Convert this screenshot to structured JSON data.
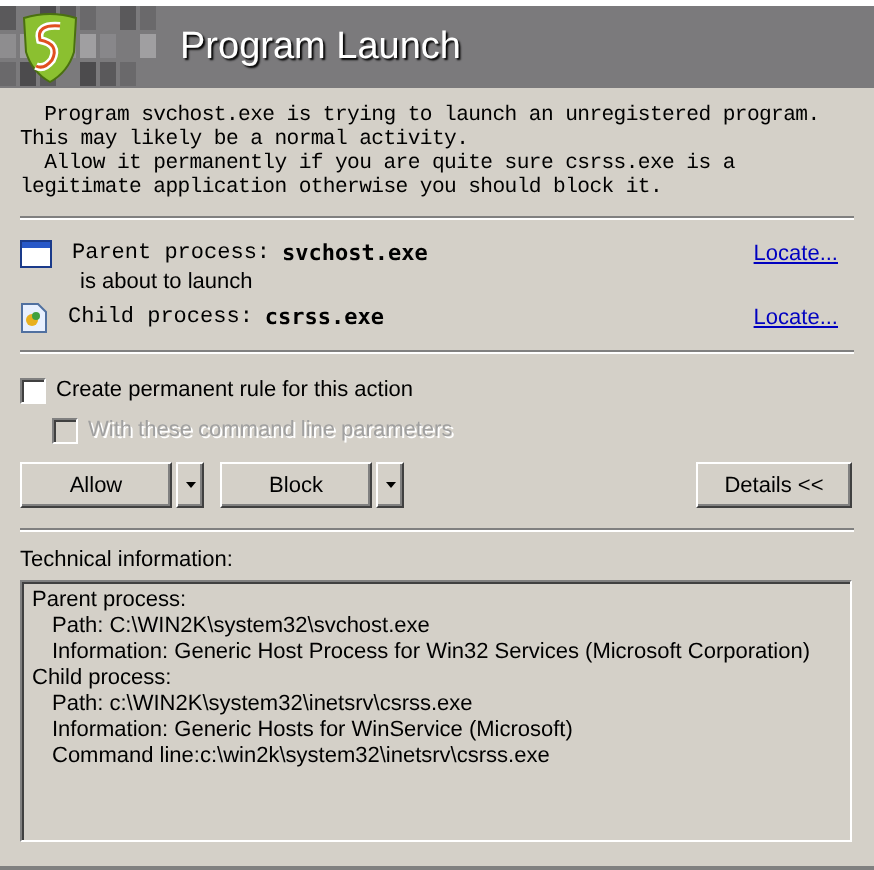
{
  "window": {
    "title": "Program Launch"
  },
  "message": "  Program svchost.exe is trying to launch an unregistered program.\nThis may likely be a normal activity.\n  Allow it permanently if you are quite sure csrss.exe is a\nlegitimate application otherwise you should block it.",
  "parent": {
    "label": "Parent process:",
    "name": "svchost.exe",
    "link": "Locate..."
  },
  "between": "is about to launch",
  "child": {
    "label": "Child process:",
    "name": "csrss.exe",
    "link": "Locate..."
  },
  "options": [
    {
      "label": "Create permanent rule for this action",
      "checked": false,
      "disabled": false
    },
    {
      "label": "With these command line parameters",
      "checked": false,
      "disabled": true
    }
  ],
  "buttons": [
    {
      "label": "Allow",
      "kind": "split"
    },
    {
      "label": "Block",
      "kind": "split"
    },
    {
      "label": "Details <<",
      "kind": "plain"
    }
  ],
  "technical": {
    "label": "Technical information:",
    "lines": [
      {
        "text": "Parent process:",
        "children": [
          {
            "text": "Path: C:\\WIN2K\\system32\\svchost.exe"
          },
          {
            "text": "Information: Generic Host Process for Win32 Services (Microsoft Corporation)"
          }
        ]
      },
      {
        "text": "Child process:",
        "children": [
          {
            "text": "Path: c:\\WIN2K\\system32\\inetsrv\\csrss.exe"
          },
          {
            "text": "Information: Generic Hosts for WinService (Microsoft)"
          },
          {
            "text": "Command line:c:\\win2k\\system32\\inetsrv\\csrss.exe"
          }
        ]
      }
    ]
  }
}
